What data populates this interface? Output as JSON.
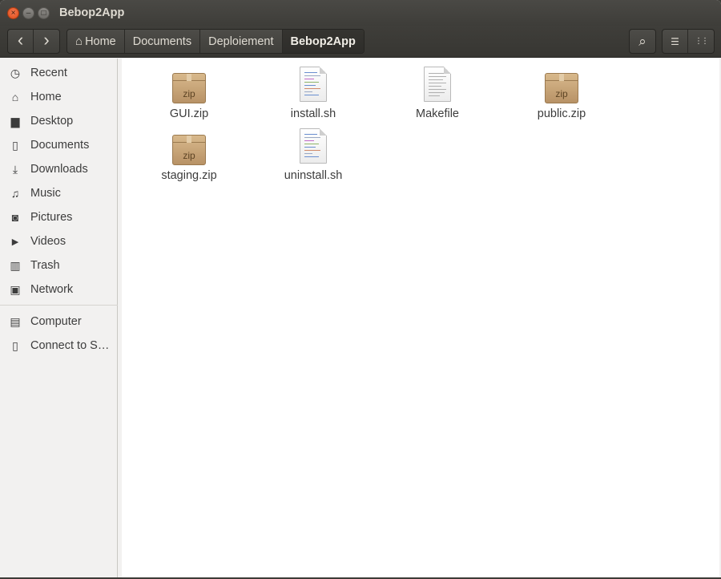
{
  "window": {
    "title": "Bebop2App",
    "controls": {
      "close": "×",
      "minimize": "–",
      "maximize": "□"
    }
  },
  "toolbar": {
    "back_glyph": "‹",
    "forward_glyph": "›",
    "breadcrumbs": [
      "Home",
      "Documents",
      "Deploiement",
      "Bebop2App"
    ],
    "home_glyph": "⌂",
    "search_glyph": "⌕",
    "list_view_glyph": "☰",
    "grid_view_glyph": "⋮⋮"
  },
  "sidebar": {
    "items": [
      {
        "label": "Recent",
        "icon": "clock-icon",
        "glyph": "◷"
      },
      {
        "label": "Home",
        "icon": "home-icon",
        "glyph": "⌂"
      },
      {
        "label": "Desktop",
        "icon": "folder-icon",
        "glyph": "▆"
      },
      {
        "label": "Documents",
        "icon": "document-icon",
        "glyph": "▯"
      },
      {
        "label": "Downloads",
        "icon": "download-icon",
        "glyph": "⤓"
      },
      {
        "label": "Music",
        "icon": "music-icon",
        "glyph": "♫"
      },
      {
        "label": "Pictures",
        "icon": "camera-icon",
        "glyph": "◙"
      },
      {
        "label": "Videos",
        "icon": "video-icon",
        "glyph": "▶"
      },
      {
        "label": "Trash",
        "icon": "trash-icon",
        "glyph": "▥"
      },
      {
        "label": "Network",
        "icon": "network-icon",
        "glyph": "▣"
      },
      {
        "label": "Computer",
        "icon": "computer-icon",
        "glyph": "▤"
      },
      {
        "label": "Connect to S…",
        "icon": "server-icon",
        "glyph": "▯"
      }
    ]
  },
  "files": [
    {
      "name": "GUI.zip",
      "type": "zip",
      "badge": "zip"
    },
    {
      "name": "install.sh",
      "type": "script"
    },
    {
      "name": "Makefile",
      "type": "text"
    },
    {
      "name": "public.zip",
      "type": "zip",
      "badge": "zip"
    },
    {
      "name": "staging.zip",
      "type": "zip",
      "badge": "zip"
    },
    {
      "name": "uninstall.sh",
      "type": "script"
    }
  ]
}
